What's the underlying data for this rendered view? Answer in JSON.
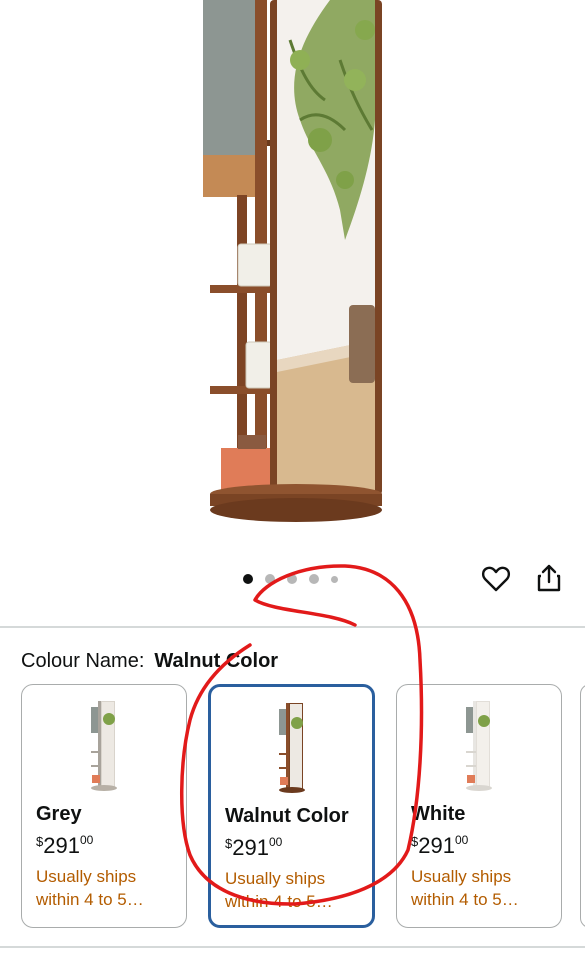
{
  "product_image": {
    "alt": "Rotating full-length mirror with walnut wooden coat rack and shelves"
  },
  "carousel": {
    "dot_count": 5,
    "active_index": 0
  },
  "actions": {
    "wishlist_icon": "heart-icon",
    "share_icon": "share-icon"
  },
  "variation": {
    "label": "Colour Name:",
    "selected_value": "Walnut Color"
  },
  "swatches": [
    {
      "name": "Grey",
      "currency": "$",
      "price_whole": "291",
      "price_fraction": "00",
      "shipping": "Usually ships within 4 to 5…"
    },
    {
      "name": "Walnut Color",
      "currency": "$",
      "price_whole": "291",
      "price_fraction": "00",
      "shipping": "Usually ships within 4 to 5…"
    },
    {
      "name": "White",
      "currency": "$",
      "price_whole": "291",
      "price_fraction": "00",
      "shipping": "Usually ships within 4 to 5…"
    }
  ],
  "colors": {
    "selected_border": "#2a5f9e",
    "shipping_text": "#b35c00",
    "annotation": "#e21a1a",
    "wood": "#8a4e2b"
  }
}
